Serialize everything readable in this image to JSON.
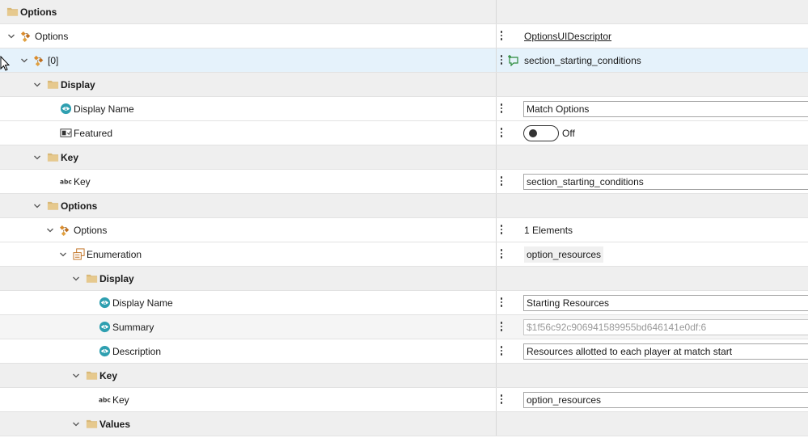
{
  "rows": [
    {
      "label": "Options",
      "indent": 0,
      "chevron": false,
      "icon": "folder-icon",
      "type": "folder",
      "value_kind": "none"
    },
    {
      "label": "Options",
      "indent": 1,
      "chevron": true,
      "icon": "struct-icon",
      "type": "normal",
      "value_kind": "link",
      "value": "OptionsUIDescriptor"
    },
    {
      "label": "[0]",
      "indent": 2,
      "chevron": true,
      "icon": "struct-icon",
      "type": "selected",
      "value_kind": "plain",
      "value": "section_starting_conditions",
      "new_icon": true
    },
    {
      "label": "Display",
      "indent": 3,
      "chevron": true,
      "icon": "folder-icon",
      "type": "folder",
      "value_kind": "none"
    },
    {
      "label": "Display Name",
      "indent": 4,
      "chevron": false,
      "icon": "localized-text-icon",
      "type": "normal",
      "value_kind": "input",
      "value": "Match Options"
    },
    {
      "label": "Featured",
      "indent": 4,
      "chevron": false,
      "icon": "boolean-icon",
      "type": "normal",
      "value_kind": "toggle",
      "value": "Off"
    },
    {
      "label": "Key",
      "indent": 3,
      "chevron": true,
      "icon": "folder-icon",
      "type": "folder",
      "value_kind": "none"
    },
    {
      "label": "Key",
      "indent": 4,
      "chevron": false,
      "icon": "string-icon",
      "type": "normal",
      "value_kind": "input",
      "value": "section_starting_conditions"
    },
    {
      "label": "Options",
      "indent": 3,
      "chevron": true,
      "icon": "folder-icon",
      "type": "folder",
      "value_kind": "none"
    },
    {
      "label": "Options",
      "indent": 4,
      "chevron": true,
      "icon": "struct-icon",
      "type": "normal",
      "value_kind": "plain",
      "value": "1 Elements"
    },
    {
      "label": "Enumeration",
      "indent": 5,
      "chevron": true,
      "icon": "enum-icon",
      "type": "normal",
      "value_kind": "chip",
      "value": "option_resources"
    },
    {
      "label": "Display",
      "indent": 6,
      "chevron": true,
      "icon": "folder-icon",
      "type": "folder",
      "value_kind": "none"
    },
    {
      "label": "Display Name",
      "indent": 7,
      "chevron": false,
      "icon": "localized-text-icon",
      "type": "normal",
      "value_kind": "input",
      "value": "Starting Resources"
    },
    {
      "label": "Summary",
      "indent": 7,
      "chevron": false,
      "icon": "localized-text-icon",
      "type": "alt",
      "value_kind": "input-dim",
      "value": "$1f56c92c906941589955bd646141e0df:6"
    },
    {
      "label": "Description",
      "indent": 7,
      "chevron": false,
      "icon": "localized-text-icon",
      "type": "normal",
      "value_kind": "input",
      "value": "Resources allotted to each player at match start"
    },
    {
      "label": "Key",
      "indent": 6,
      "chevron": true,
      "icon": "folder-icon",
      "type": "folder",
      "value_kind": "none"
    },
    {
      "label": "Key",
      "indent": 7,
      "chevron": false,
      "icon": "string-icon",
      "type": "normal",
      "value_kind": "input",
      "value": "option_resources"
    },
    {
      "label": "Values",
      "indent": 6,
      "chevron": true,
      "icon": "folder-icon",
      "type": "folder",
      "value_kind": "none"
    }
  ]
}
